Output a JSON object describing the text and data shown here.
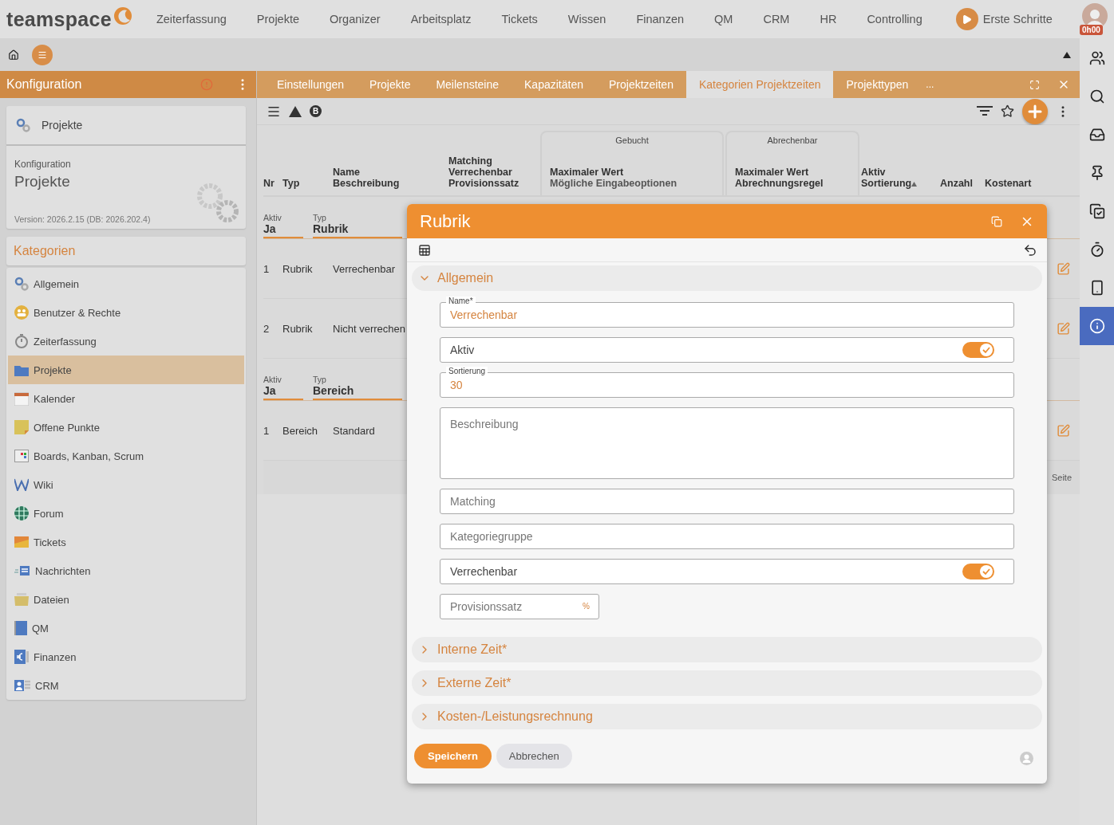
{
  "nav": {
    "logo": "teamspace",
    "items": [
      "Zeiterfassung",
      "Projekte",
      "Organizer",
      "Arbeitsplatz",
      "Tickets",
      "Wissen",
      "Finanzen",
      "QM",
      "CRM",
      "HR",
      "Controlling"
    ],
    "start": "Erste Schritte",
    "timer": "0h00"
  },
  "left_panel": {
    "title": "Konfiguration",
    "module": "Projekte",
    "info": {
      "label": "Konfiguration",
      "title": "Projekte",
      "version": "Version: 2026.2.15 (DB: 2026.202.4)"
    },
    "categories_title": "Kategorien",
    "categories": [
      {
        "label": "Allgemein",
        "selected": false
      },
      {
        "label": "Benutzer & Rechte",
        "selected": false
      },
      {
        "label": "Zeiterfassung",
        "selected": false
      },
      {
        "label": "Projekte",
        "selected": true
      },
      {
        "label": "Kalender",
        "selected": false
      },
      {
        "label": "Offene Punkte",
        "selected": false
      },
      {
        "label": "Boards, Kanban, Scrum",
        "selected": false
      },
      {
        "label": "Wiki",
        "selected": false
      },
      {
        "label": "Forum",
        "selected": false
      },
      {
        "label": "Tickets",
        "selected": false
      },
      {
        "label": "Nachrichten",
        "selected": false
      },
      {
        "label": "Dateien",
        "selected": false
      },
      {
        "label": "QM",
        "selected": false
      },
      {
        "label": "Finanzen",
        "selected": false
      },
      {
        "label": "CRM",
        "selected": false
      }
    ]
  },
  "tabs": [
    {
      "label": "Einstellungen",
      "selected": false
    },
    {
      "label": "Projekte",
      "selected": false
    },
    {
      "label": "Meilensteine",
      "selected": false
    },
    {
      "label": "Kapazitäten",
      "selected": false
    },
    {
      "label": "Projektzeiten",
      "selected": false
    },
    {
      "label": "Kategorien Projektzeiten",
      "selected": true
    },
    {
      "label": "Projekttypen",
      "selected": false
    }
  ],
  "tabs_more": "...",
  "toolbar_badge": "B",
  "table": {
    "column_groups": [
      "Gebucht",
      "Abrechenbar"
    ],
    "columns": [
      {
        "lines": [
          "Nr"
        ],
        "sorted": false
      },
      {
        "lines": [
          "Typ"
        ],
        "sorted": false
      },
      {
        "lines": [
          "Name",
          "Beschreibung"
        ],
        "sorted": false
      },
      {
        "lines": [
          "Matching",
          "Verrechenbar",
          "Provisionssatz"
        ],
        "sorted": false
      },
      {
        "lines": [
          "Maximaler Wert",
          "Mögliche Eingabeoptionen"
        ],
        "sorted": false
      },
      {
        "lines": [
          "Maximaler Wert",
          "Abrechnungsregel"
        ],
        "sorted": false
      },
      {
        "lines": [
          "Aktiv",
          "Sortierung"
        ],
        "sorted": true
      },
      {
        "lines": [
          "Anzahl"
        ],
        "sorted": false
      },
      {
        "lines": [
          "Kostenart"
        ],
        "sorted": false
      }
    ],
    "groups": [
      {
        "fields": [
          {
            "label": "Aktiv",
            "value": "Ja"
          },
          {
            "label": "Typ",
            "value": "Rubrik"
          }
        ],
        "rows": [
          {
            "nr": "1",
            "typ": "Rubrik",
            "name": "Verrechenbar"
          },
          {
            "nr": "2",
            "typ": "Rubrik",
            "name": "Nicht verrechen"
          }
        ]
      },
      {
        "fields": [
          {
            "label": "Aktiv",
            "value": "Ja"
          },
          {
            "label": "Typ",
            "value": "Bereich"
          }
        ],
        "rows": [
          {
            "nr": "1",
            "typ": "Bereich",
            "name": "Standard"
          }
        ]
      }
    ],
    "footer": "Seite"
  },
  "dialog": {
    "title": "Rubrik",
    "sections": [
      {
        "title": "Allgemein",
        "expanded": true,
        "fields": [
          {
            "kind": "text",
            "label": "Name*",
            "value": "Verrechenbar"
          },
          {
            "kind": "toggle",
            "label": "Aktiv",
            "on": true
          },
          {
            "kind": "text",
            "label": "Sortierung",
            "value": "30"
          },
          {
            "kind": "textarea",
            "placeholder": "Beschreibung"
          },
          {
            "kind": "text",
            "placeholder": "Matching"
          },
          {
            "kind": "text",
            "placeholder": "Kategoriegruppe"
          },
          {
            "kind": "toggle",
            "label": "Verrechenbar",
            "on": true
          },
          {
            "kind": "percent",
            "placeholder": "Provisionssatz",
            "suffix": "%"
          }
        ]
      },
      {
        "title": "Interne Zeit*",
        "expanded": false
      },
      {
        "title": "Externe Zeit*",
        "expanded": false
      },
      {
        "title": "Kosten-/Leistungsrechnung",
        "expanded": false
      }
    ],
    "save": "Speichern",
    "cancel": "Abbrechen"
  }
}
